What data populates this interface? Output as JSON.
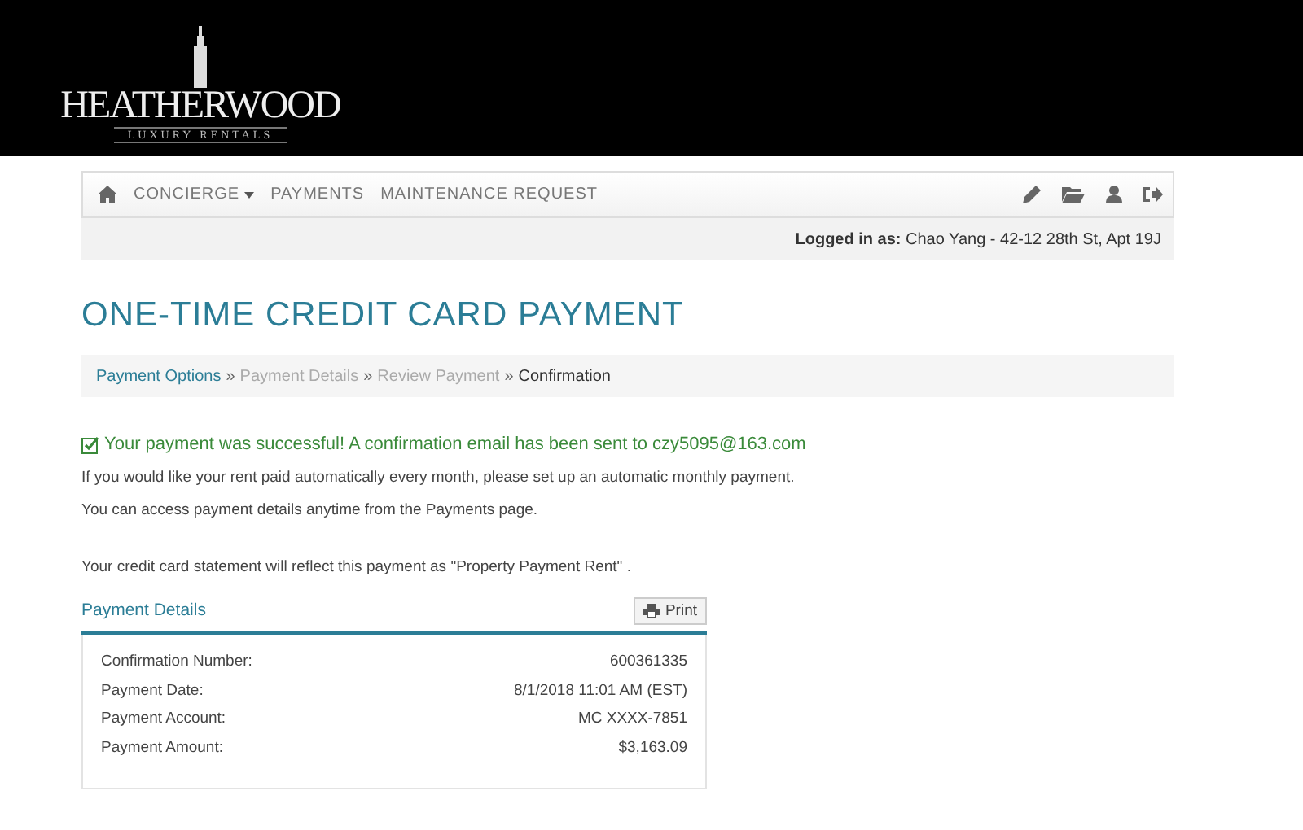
{
  "brand": {
    "name": "HEATHERWOOD",
    "tagline": "LUXURY RENTALS"
  },
  "nav": {
    "items": [
      {
        "label": "CONCIERGE",
        "dropdown": true
      },
      {
        "label": "PAYMENTS",
        "dropdown": false
      },
      {
        "label": "MAINTENANCE REQUEST",
        "dropdown": false
      }
    ]
  },
  "logged_in": "**Logged in as:** Chao Yang - 42-12 28th St, Apt 19J",
  "page_title": "ONE-TIME CREDIT CARD PAYMENT",
  "breadcrumb": [
    {
      "label": "Payment Options",
      "kind": "link"
    },
    {
      "label": "Payment Details",
      "kind": "disabled"
    },
    {
      "label": "Review Payment",
      "kind": "disabled"
    },
    {
      "label": "Confirmation",
      "kind": "current"
    }
  ],
  "breadcrumb_separator": "»",
  "success_message": "Your payment was successful! A confirmation email has been sent to czy5095@163.com",
  "paragraphs": [
    "If you would like your rent paid automatically every month, please set up an automatic monthly payment.",
    "You can access payment details anytime from the Payments page.",
    "Your credit card statement will reflect this payment as \"Property Payment Rent\" ."
  ],
  "details": {
    "title": "Payment Details",
    "print_button": "Print",
    "rows": [
      {
        "label": "Confirmation Number:",
        "value": "600361335"
      },
      {
        "label": "Payment Date:",
        "value": "8/1/2018 11:01 AM (EST)"
      },
      {
        "label": "Payment Account:",
        "value": "MC XXXX-7851"
      },
      {
        "label": "Payment Amount:",
        "value": "$3,163.09"
      }
    ]
  }
}
